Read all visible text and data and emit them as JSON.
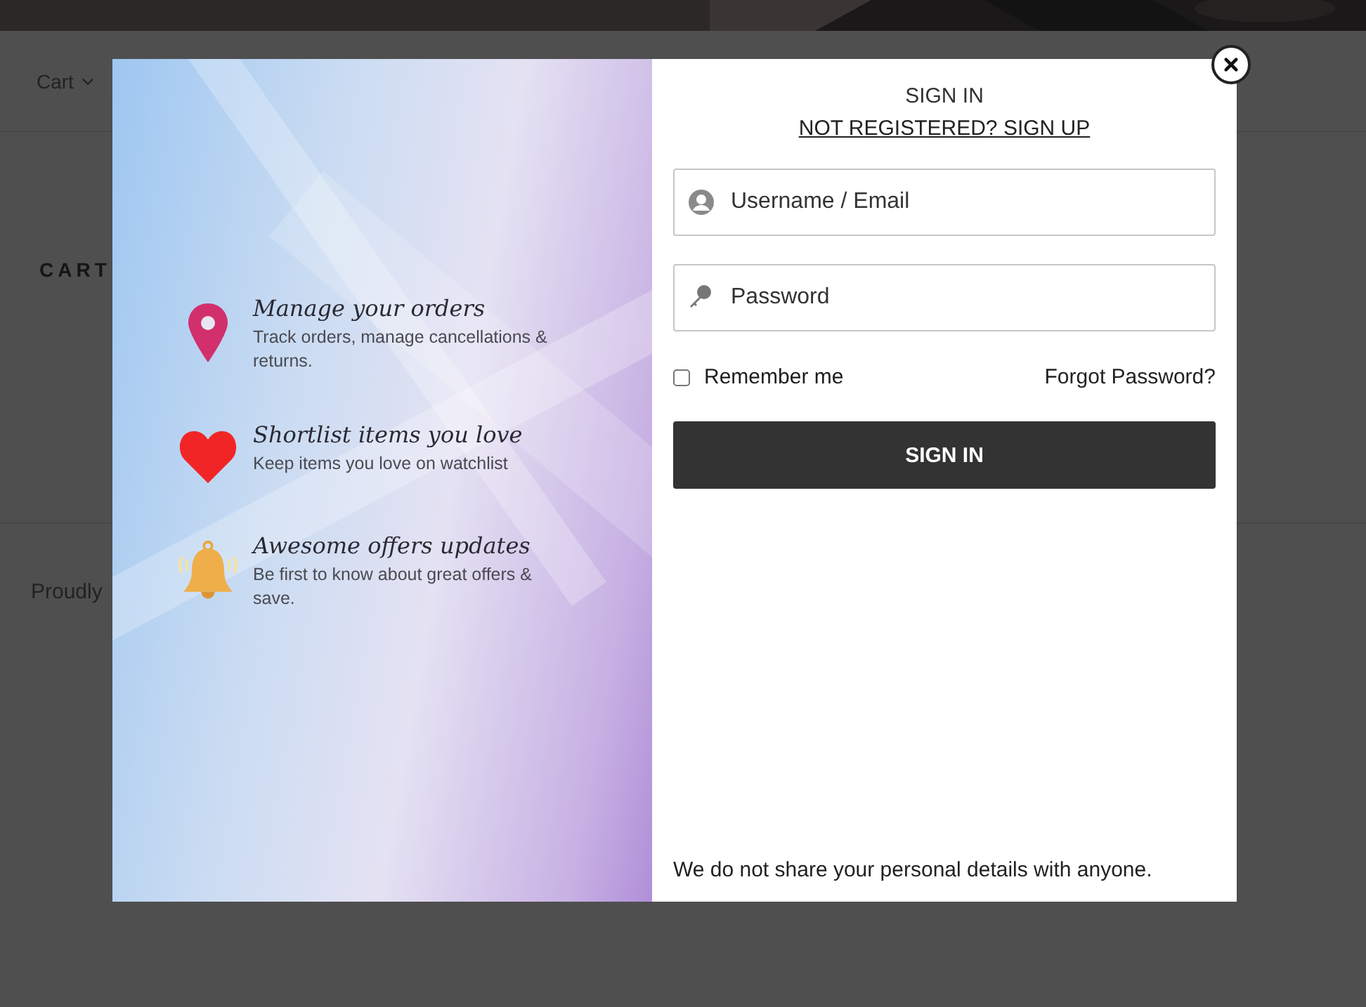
{
  "page": {
    "nav": {
      "label": "Cart"
    },
    "heading": "CART",
    "footer_text": "Proudly"
  },
  "modal": {
    "features": [
      {
        "kind": "pin",
        "title": "Manage your orders",
        "description": "Track orders, manage cancellations & returns."
      },
      {
        "kind": "heart",
        "title": "Shortlist items you love",
        "description": "Keep items you love on watchlist"
      },
      {
        "kind": "bell",
        "title": "Awesome offers updates",
        "description": "Be first to know about great offers & save."
      }
    ],
    "title": "SIGN IN",
    "signup_link": "NOT REGISTERED? SIGN UP",
    "fields": [
      {
        "kind": "user",
        "placeholder": "Username / Email"
      },
      {
        "kind": "key",
        "placeholder": "Password"
      }
    ],
    "remember": {
      "label": "Remember me",
      "checked": false
    },
    "forgot_link": "Forgot Password?",
    "submit": "SIGN IN",
    "privacy_note": "We do not share your personal details with anyone."
  }
}
